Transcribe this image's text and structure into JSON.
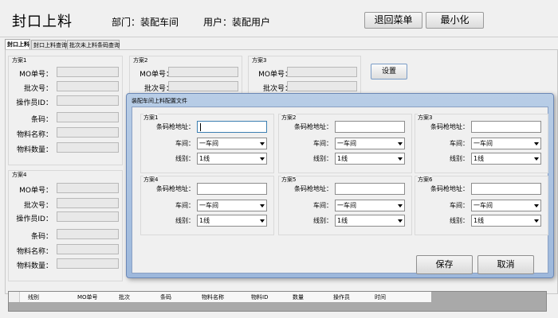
{
  "header": {
    "title": "封口上料",
    "dept": "部门：装配车间",
    "user": "用户：装配用户",
    "back_btn": "退回菜单",
    "min_btn": "最小化"
  },
  "tabs": [
    "封口上料",
    "封口上料查询",
    "批次未上料条码查询"
  ],
  "schemes": [
    {
      "title": "方案1",
      "labels": [
        "MO单号：",
        "批次号：",
        "操作员ID：",
        "条码：",
        "物料名称：",
        "物料数量："
      ]
    },
    {
      "title": "方案2",
      "labels": [
        "MO单号：",
        "批次号："
      ]
    },
    {
      "title": "方案3",
      "labels": [
        "MO单号：",
        "批次号："
      ]
    },
    {
      "title": "方案4",
      "labels": [
        "MO单号：",
        "批次号：",
        "操作员ID：",
        "条码：",
        "物料名称：",
        "物料数量："
      ]
    }
  ],
  "settings_btn": "设置",
  "grid": {
    "columns": [
      "线别",
      "MO单号",
      "批次",
      "条码",
      "物料名称",
      "物料ID",
      "数量",
      "操作员",
      "时间"
    ]
  },
  "dialog": {
    "title": "装配车间上料配置文件",
    "schemes": [
      {
        "title": "方案1",
        "scanner_label": "条码枪地址：",
        "workshop_label": "车间：",
        "line_label": "线别：",
        "workshop": "一车间",
        "line": "1线"
      },
      {
        "title": "方案2",
        "scanner_label": "条码枪地址：",
        "workshop_label": "车间：",
        "line_label": "线别：",
        "workshop": "一车间",
        "line": "1线"
      },
      {
        "title": "方案3",
        "scanner_label": "条码枪地址：",
        "workshop_label": "车间：",
        "line_label": "线别：",
        "workshop": "一车间",
        "line": "1线"
      },
      {
        "title": "方案4",
        "scanner_label": "条码枪地址：",
        "workshop_label": "车间：",
        "line_label": "线别：",
        "workshop": "一车间",
        "line": "1线"
      },
      {
        "title": "方案5",
        "scanner_label": "条码枪地址：",
        "workshop_label": "车间：",
        "line_label": "线别：",
        "workshop": "一车间",
        "line": "1线"
      },
      {
        "title": "方案6",
        "scanner_label": "条码枪地址：",
        "workshop_label": "车间：",
        "line_label": "线别：",
        "workshop": "一车间",
        "line": "1线"
      }
    ],
    "save_btn": "保存",
    "cancel_btn": "取消"
  }
}
